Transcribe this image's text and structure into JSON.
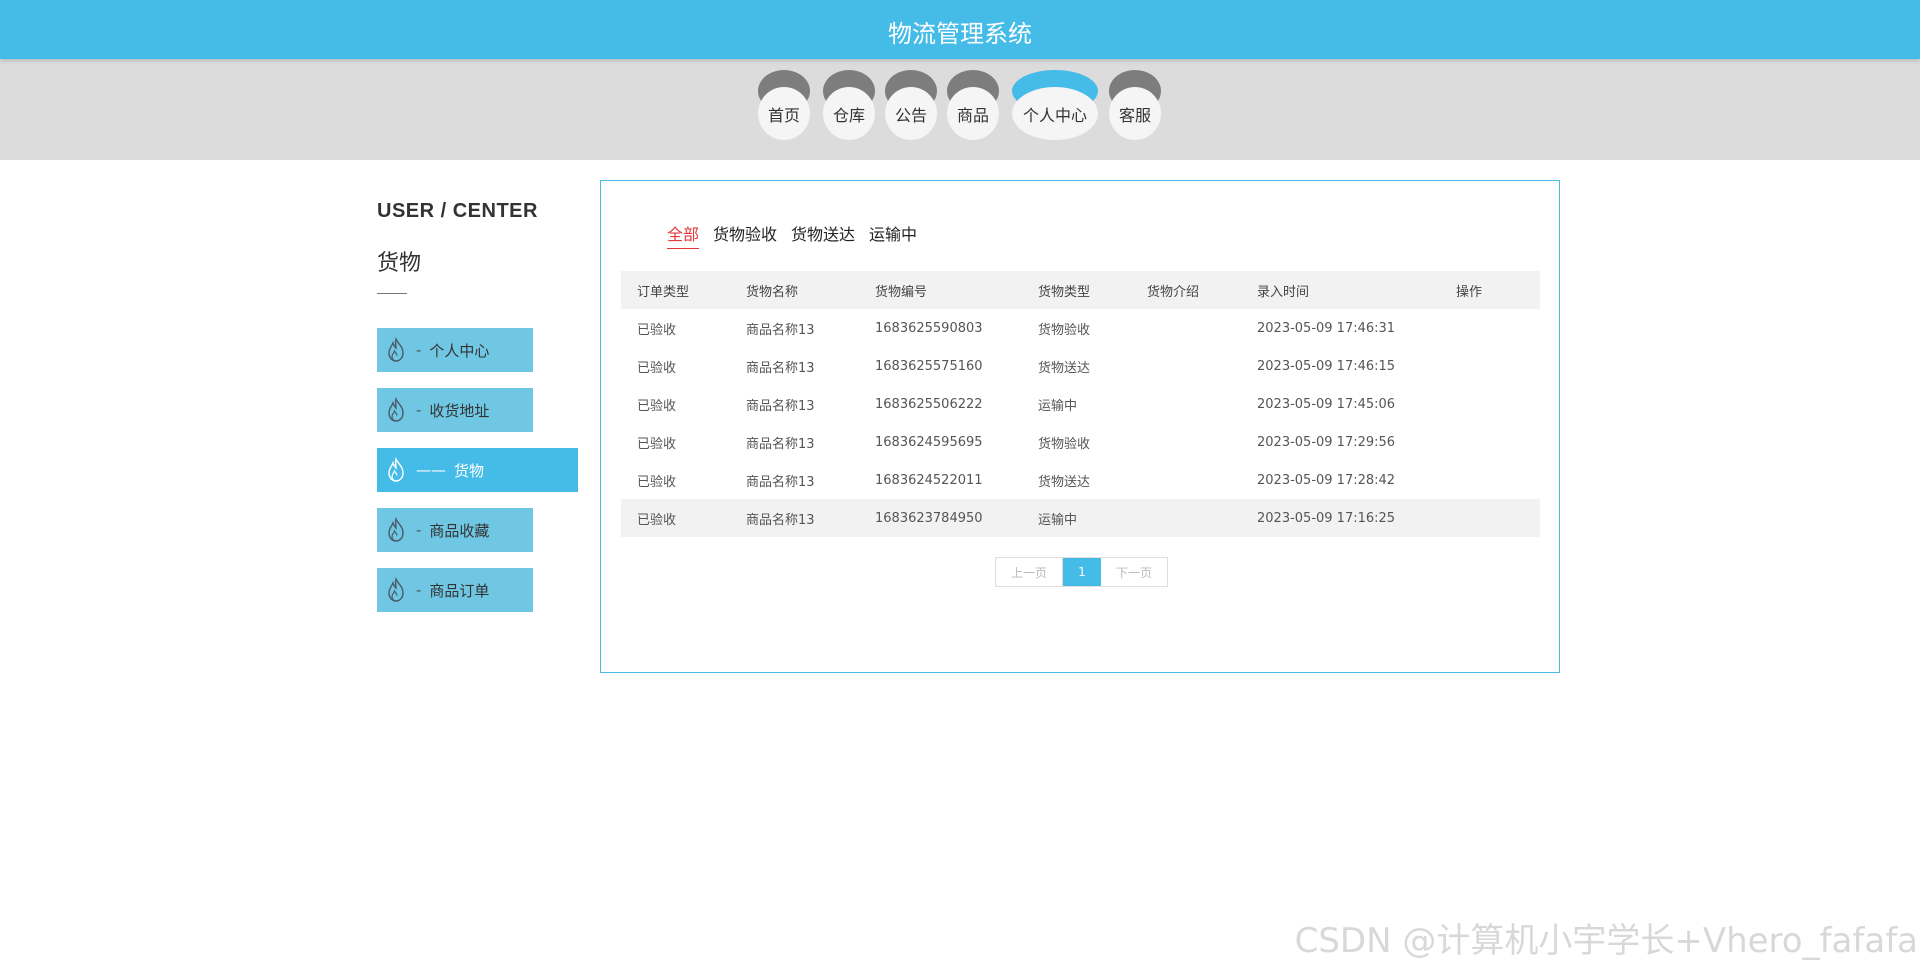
{
  "header": {
    "title": "物流管理系统"
  },
  "nav": {
    "items": [
      {
        "label": "首页"
      },
      {
        "label": "仓库"
      },
      {
        "label": "公告"
      },
      {
        "label": "商品"
      },
      {
        "label": "个人中心"
      },
      {
        "label": "客服"
      }
    ],
    "active": "个人中心"
  },
  "sidebar": {
    "title": "USER / CENTER",
    "subtitle": "货物",
    "items": [
      {
        "label": "个人中心",
        "dash": "-"
      },
      {
        "label": "收货地址",
        "dash": "-"
      },
      {
        "label": "货物",
        "dash": "——"
      },
      {
        "label": "商品收藏",
        "dash": "-"
      },
      {
        "label": "商品订单",
        "dash": "-"
      }
    ],
    "active": "货物"
  },
  "tabs": {
    "items": [
      "全部",
      "货物验收",
      "货物送达",
      "运输中"
    ],
    "active": "全部"
  },
  "table": {
    "columns": [
      "订单类型",
      "货物名称",
      "货物编号",
      "货物类型",
      "货物介绍",
      "录入时间",
      "操作"
    ],
    "rows": [
      [
        "已验收",
        "商品名称13",
        "1683625590803",
        "货物验收",
        "",
        "2023-05-09 17:46:31",
        ""
      ],
      [
        "已验收",
        "商品名称13",
        "1683625575160",
        "货物送达",
        "",
        "2023-05-09 17:46:15",
        ""
      ],
      [
        "已验收",
        "商品名称13",
        "1683625506222",
        "运输中",
        "",
        "2023-05-09 17:45:06",
        ""
      ],
      [
        "已验收",
        "商品名称13",
        "1683624595695",
        "货物验收",
        "",
        "2023-05-09 17:29:56",
        ""
      ],
      [
        "已验收",
        "商品名称13",
        "1683624522011",
        "货物送达",
        "",
        "2023-05-09 17:28:42",
        ""
      ],
      [
        "已验收",
        "商品名称13",
        "1683623784950",
        "运输中",
        "",
        "2023-05-09 17:16:25",
        ""
      ]
    ]
  },
  "pager": {
    "prev": "上一页",
    "current": "1",
    "next": "下一页"
  },
  "watermark": "CSDN @计算机小宇学长+Vhero_fafafa",
  "colors": {
    "accent": "#45bbe8",
    "active_tab": "#e4393c",
    "nav_cap": "#7d7d7d"
  }
}
